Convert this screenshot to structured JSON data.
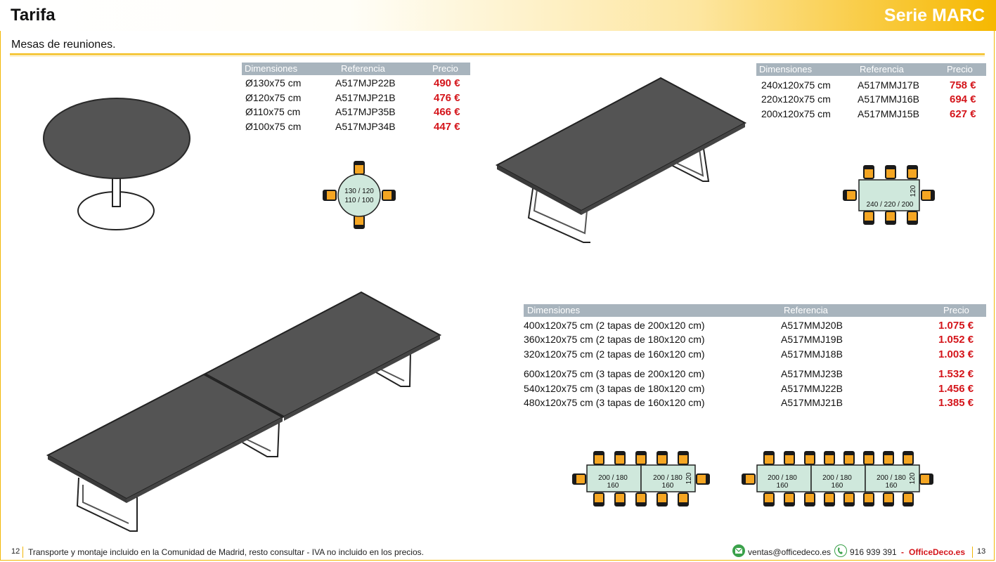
{
  "header": {
    "title": "Tarifa",
    "series": "Serie MARC"
  },
  "subtitle": "Mesas de reuniones.",
  "table_round": {
    "headers": [
      "Dimensiones",
      "Referencia",
      "Precio"
    ],
    "rows": [
      {
        "dim": "Ø130x75 cm",
        "ref": "A517MJP22B",
        "price": "490 €"
      },
      {
        "dim": "Ø120x75 cm",
        "ref": "A517MJP21B",
        "price": "476 €"
      },
      {
        "dim": "Ø110x75 cm",
        "ref": "A517MJP35B",
        "price": "466 €"
      },
      {
        "dim": "Ø100x75 cm",
        "ref": "A517MJP34B",
        "price": "447 €"
      }
    ]
  },
  "table_rect": {
    "headers": [
      "Dimensiones",
      "Referencia",
      "Precio"
    ],
    "rows": [
      {
        "dim": "240x120x75 cm",
        "ref": "A517MMJ17B",
        "price": "758 €"
      },
      {
        "dim": "220x120x75 cm",
        "ref": "A517MMJ16B",
        "price": "694 €"
      },
      {
        "dim": "200x120x75 cm",
        "ref": "A517MMJ15B",
        "price": "627 €"
      }
    ]
  },
  "table_long": {
    "headers": [
      "Dimensiones",
      "Referencia",
      "Precio"
    ],
    "rows": [
      {
        "dim": "400x120x75 cm (2 tapas de 200x120 cm)",
        "ref": "A517MMJ20B",
        "price": "1.075 €"
      },
      {
        "dim": "360x120x75 cm (2 tapas de 180x120 cm)",
        "ref": "A517MMJ19B",
        "price": "1.052 €"
      },
      {
        "dim": "320x120x75 cm (2 tapas de 160x120 cm)",
        "ref": "A517MMJ18B",
        "price": "1.003 €"
      },
      {
        "dim": "600x120x75 cm (3 tapas de 200x120 cm)",
        "ref": "A517MMJ23B",
        "price": "1.532 €"
      },
      {
        "dim": "540x120x75 cm (3 tapas de 180x120 cm)",
        "ref": "A517MMJ22B",
        "price": "1.456 €"
      },
      {
        "dim": "480x120x75 cm (3 tapas de 160x120 cm)",
        "ref": "A517MMJ21B",
        "price": "1.385 €"
      }
    ]
  },
  "plans": {
    "round": {
      "line1": "130 / 120",
      "line2": "110 / 100"
    },
    "rect": {
      "length": "240 / 220 / 200",
      "width": "120"
    },
    "long2": {
      "seg1": "200 / 180",
      "seg2": "160",
      "width": "120"
    },
    "long3": {
      "seg1": "200 / 180",
      "seg2": "160",
      "width": "120"
    }
  },
  "footer": {
    "page_left": "12",
    "note": "Transporte y montaje incluido en la Comunidad de Madrid, resto consultar - IVA no incluido en los precios.",
    "email": "ventas@officedeco.es",
    "phone": "916 939 391",
    "sep": "-",
    "brand": "OfficeDeco.es",
    "page_right": "13"
  },
  "colors": {
    "accent": "#f2b705",
    "price": "#d4151b",
    "table_header": "#a8b4bd",
    "tabletop": "#555555",
    "plan_fill": "#cfe8dc"
  }
}
